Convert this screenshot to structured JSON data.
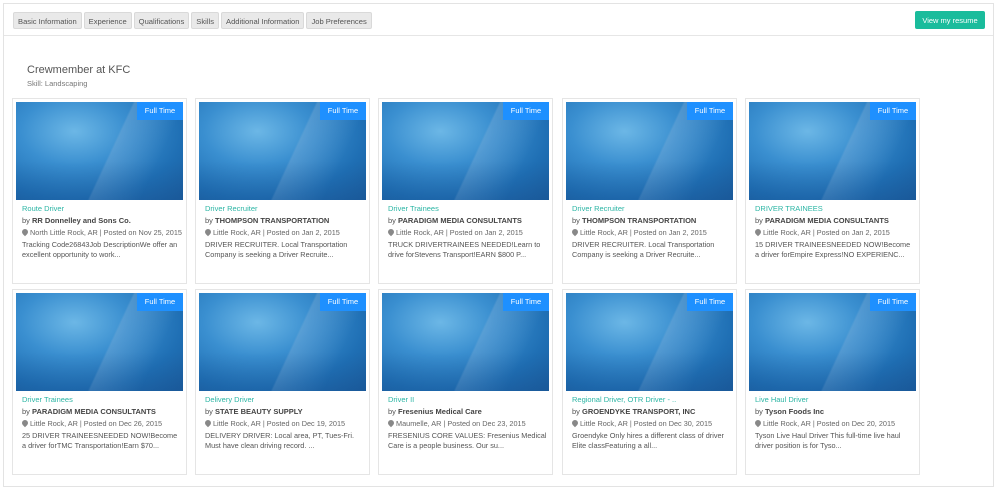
{
  "tabs": [
    "Basic Information",
    "Experience",
    "Qualifications",
    "Skills",
    "Additional Information",
    "Job Preferences"
  ],
  "resume_button": "View my resume",
  "section": {
    "title": "Crewmember at KFC",
    "skill": "Skill: Landscaping"
  },
  "jobs": [
    {
      "badge": "Full Time",
      "title": "Route Driver",
      "by": "by",
      "company": "RR Donnelley and Sons Co.",
      "meta": "North Little Rock, AR | Posted on Nov 25, 2015",
      "desc": "Tracking Code26843Job DescriptionWe offer an excellent opportunity to work..."
    },
    {
      "badge": "Full Time",
      "title": "Driver Recruiter",
      "by": "by",
      "company": "THOMPSON TRANSPORTATION",
      "meta": "Little Rock, AR | Posted on Jan 2, 2015",
      "desc": "DRIVER RECRUITER. Local Transportation Company is seeking a Driver Recruite..."
    },
    {
      "badge": "Full Time",
      "title": "Driver Trainees",
      "by": "by",
      "company": "PARADIGM MEDIA CONSULTANTS",
      "meta": "Little Rock, AR | Posted on Jan 2, 2015",
      "desc": "TRUCK DRIVERTRAINEES NEEDED!Learn to drive forStevens Transport!EARN $800 P..."
    },
    {
      "badge": "Full Time",
      "title": "Driver Recruiter",
      "by": "by",
      "company": "THOMPSON TRANSPORTATION",
      "meta": "Little Rock, AR | Posted on Jan 2, 2015",
      "desc": "DRIVER RECRUITER. Local Transportation Company is seeking a Driver Recruite..."
    },
    {
      "badge": "Full Time",
      "title": "DRIVER TRAINEES",
      "by": "by",
      "company": "PARADIGM MEDIA CONSULTANTS",
      "meta": "Little Rock, AR | Posted on Jan 2, 2015",
      "desc": "15 DRIVER TRAINEESNEEDED NOW!Become a driver forEmpire Express!NO EXPERIENC..."
    },
    {
      "badge": "Full Time",
      "title": "Driver Trainees",
      "by": "by",
      "company": "PARADIGM MEDIA CONSULTANTS",
      "meta": "Little Rock, AR | Posted on Dec 26, 2015",
      "desc": "25 DRIVER TRAINEESNEEDED NOW!Become a driver forTMC Transportation!Earn $70..."
    },
    {
      "badge": "Full Time",
      "title": "Delivery Driver",
      "by": "by",
      "company": "STATE BEAUTY SUPPLY",
      "meta": "Little Rock, AR | Posted on Dec 19, 2015",
      "desc": "DELIVERY DRIVER: Local area, PT, Tues-Fri. Must have clean driving record. ..."
    },
    {
      "badge": "Full Time",
      "title": "Driver II",
      "by": "by",
      "company": "Fresenius Medical Care",
      "meta": "Maumelle, AR | Posted on Dec 23, 2015",
      "desc": "FRESENIUS CORE VALUES: Fresenius Medical Care is a people business. Our su..."
    },
    {
      "badge": "Full Time",
      "title": "Regional Driver, OTR Driver - ..",
      "by": "by",
      "company": "GROENDYKE TRANSPORT, INC",
      "meta": "Little Rock, AR | Posted on Dec 30, 2015",
      "desc": "Groendyke Only hires a different class of driver Elite classFeaturing a all..."
    },
    {
      "badge": "Full Time",
      "title": "Live Haul Driver",
      "by": "by",
      "company": "Tyson Foods Inc",
      "meta": "Little Rock, AR | Posted on Dec 20, 2015",
      "desc": "Tyson Live Haul Driver This full-time live haul driver position is for Tyso..."
    }
  ],
  "colors": {
    "accent": "#1abc9c",
    "badge": "#1e90ff",
    "job_title": "#2bb5a4"
  }
}
